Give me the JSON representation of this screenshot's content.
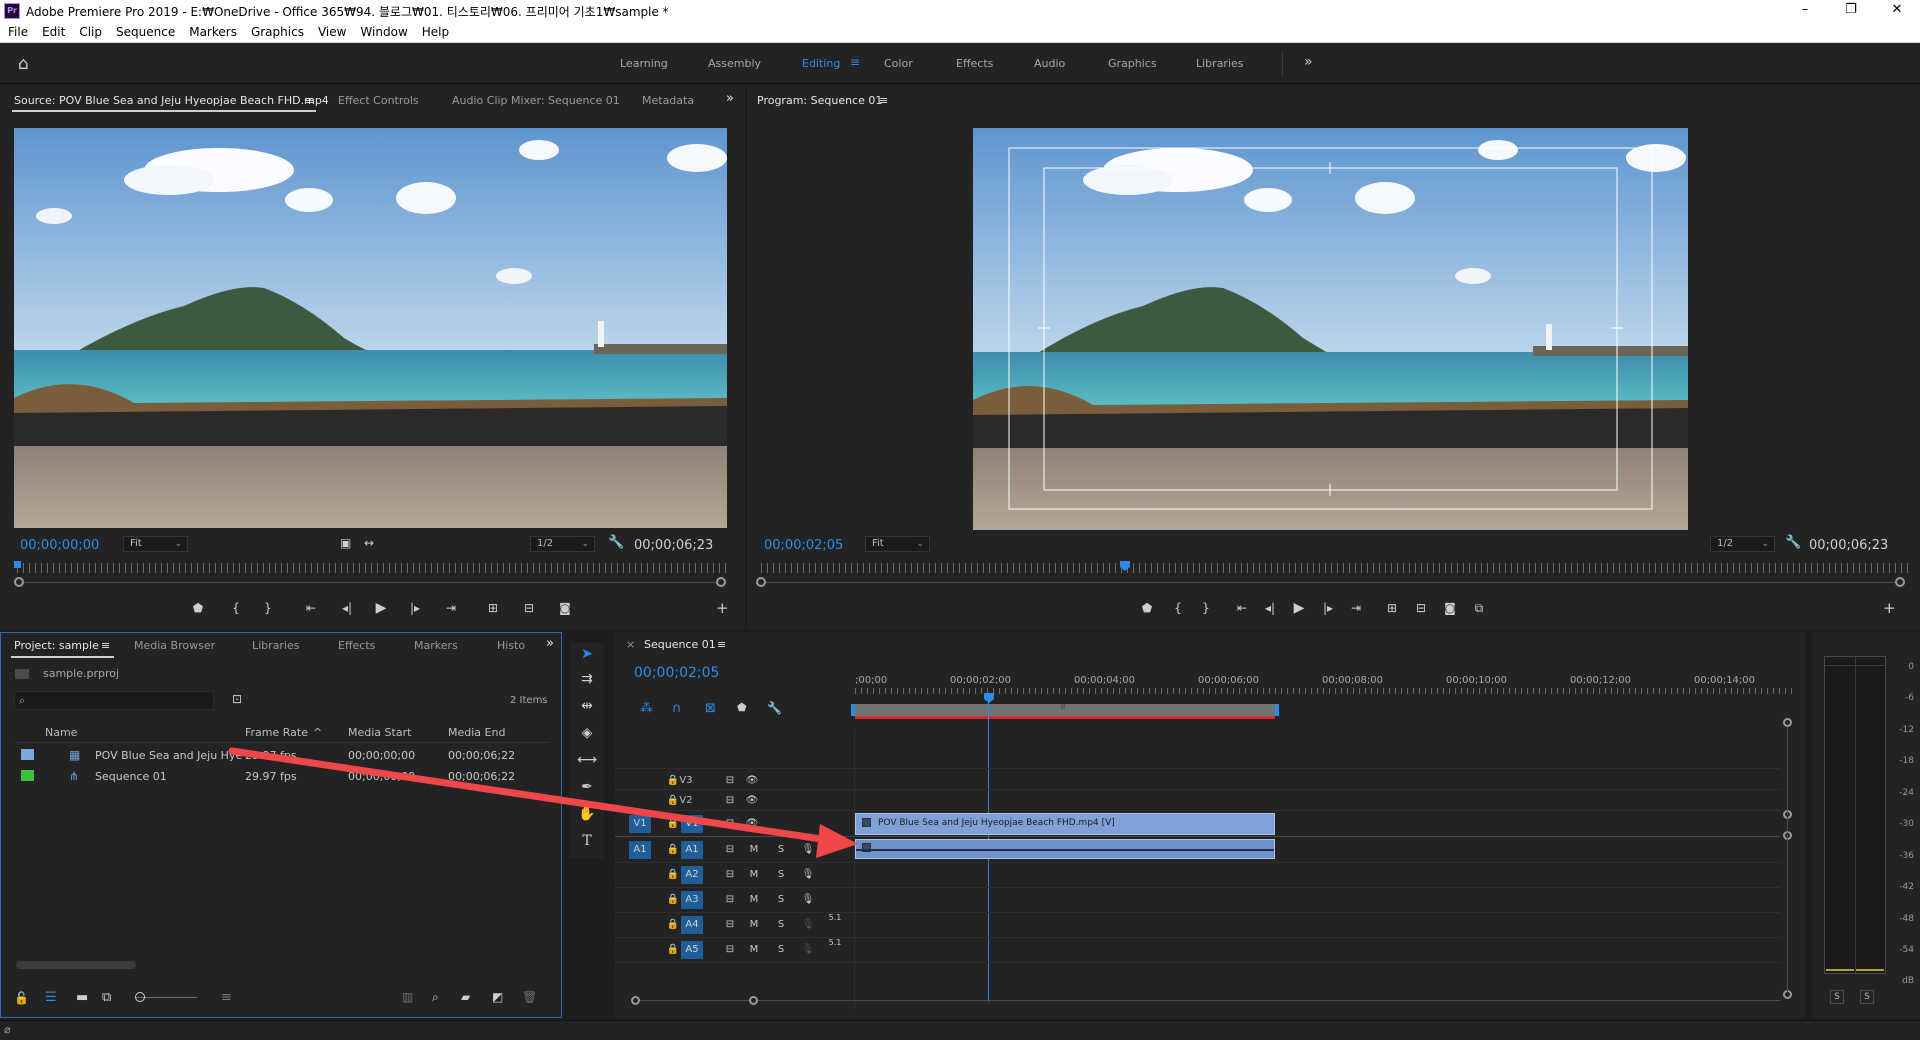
{
  "window": {
    "app_icon": "Pr",
    "title": "Adobe Premiere Pro 2019 - E:₩OneDrive - Office 365₩94. 블로그₩01. 티스토리₩06. 프리미어 기초1₩sample *",
    "minimize": "–",
    "restore": "❐",
    "close": "✕"
  },
  "menu": [
    "File",
    "Edit",
    "Clip",
    "Sequence",
    "Markers",
    "Graphics",
    "View",
    "Window",
    "Help"
  ],
  "workspaces": {
    "home_icon": "⌂",
    "items": [
      "Learning",
      "Assembly",
      "Editing",
      "Color",
      "Effects",
      "Audio",
      "Graphics",
      "Libraries"
    ],
    "active": "Editing",
    "more": "»",
    "menu_glyph": "≡"
  },
  "source_panel": {
    "tabs": [
      "Source: POV Blue Sea and Jeju Hyeopjae Beach FHD.mp4",
      "Effect Controls",
      "Audio Clip Mixer: Sequence 01",
      "Metadata"
    ],
    "menu_glyph": "≡",
    "more": "»",
    "timecode": "00;00;00;00",
    "fit": "Fit",
    "resolution": "1/2",
    "duration": "00;00;06;23",
    "plus": "+"
  },
  "program_panel": {
    "tab": "Program: Sequence 01",
    "menu_glyph": "≡",
    "timecode": "00;00;02;05",
    "fit": "Fit",
    "resolution": "1/2",
    "duration": "00;00;06;23",
    "plus": "+"
  },
  "project_panel": {
    "tabs": [
      "Project: sample",
      "Media Browser",
      "Libraries",
      "Effects",
      "Markers",
      "Histo"
    ],
    "menu_glyph": "≡",
    "more": "»",
    "file": "sample.prproj",
    "item_count": "2 Items",
    "columns": [
      "Name",
      "Frame Rate",
      "Media Start",
      "Media End"
    ],
    "sort_glyph": "^",
    "rows": [
      {
        "name": "POV Blue Sea and Jeju Hye",
        "frame_rate": "29.97 fps",
        "start": "00;00;00;00",
        "end": "00;00;06;22",
        "color": "#7fa7e0"
      },
      {
        "name": "Sequence 01",
        "frame_rate": "29.97 fps",
        "start": "00;00;00;00",
        "end": "00;00;06;22",
        "color": "#3fbf3f"
      }
    ]
  },
  "timeline": {
    "tab": "Sequence 01",
    "close": "×",
    "menu_glyph": "≡",
    "timecode": "00;00;02;05",
    "ruler_labels": [
      ";00;00",
      "00;00;02;00",
      "00;00;04;00",
      "00;00;06;00",
      "00;00;08;00",
      "00;00;10;00",
      "00;00;12;00",
      "00;00;14;00"
    ],
    "ruler_center_mark": "II",
    "tracks": [
      {
        "name": "V3",
        "source": ""
      },
      {
        "name": "V2",
        "source": ""
      },
      {
        "name": "V1",
        "source": "V1"
      },
      {
        "name": "A1",
        "source": "A1"
      },
      {
        "name": "A2",
        "source": ""
      },
      {
        "name": "A3",
        "source": ""
      },
      {
        "name": "A4",
        "source": ""
      },
      {
        "name": "A5",
        "source": ""
      }
    ],
    "audio_flags": {
      "m": "M",
      "s": "S",
      "level": "5.1"
    },
    "video_clip": "POV Blue Sea and Jeju Hyeopjae Beach FHD.mp4 [V]"
  },
  "audio_meter": {
    "labels": [
      "0",
      "-6",
      "-12",
      "-18",
      "-24",
      "-30",
      "-36",
      "-42",
      "-48",
      "-54",
      "dB"
    ],
    "solo": "S"
  },
  "colors": {
    "accent": "#2d8ceb",
    "clip_video": "#7fa1d8",
    "clip_audio": "#6f93c8",
    "arrow": "#f0484a"
  }
}
